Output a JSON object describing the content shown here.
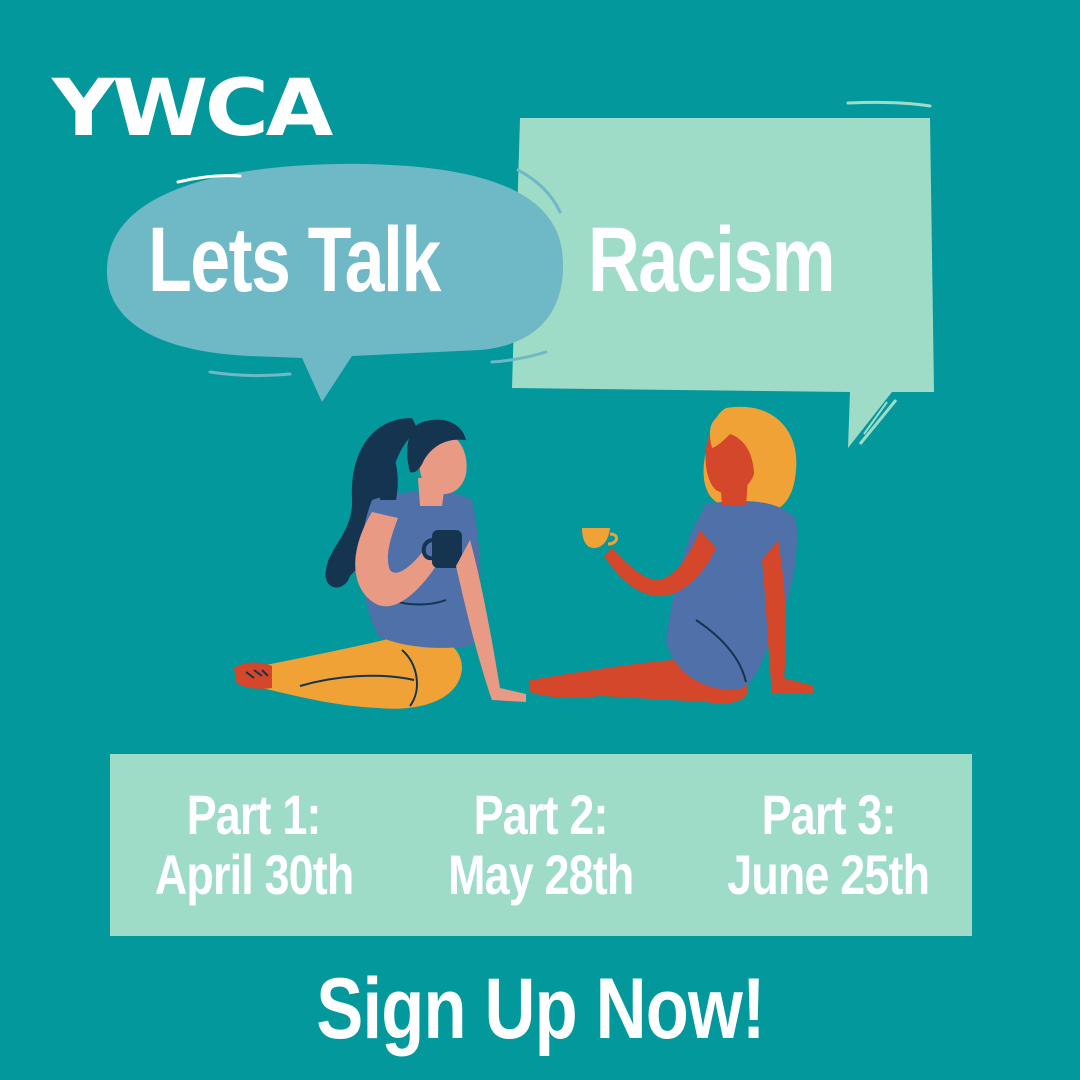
{
  "brand": {
    "logo": "YWCA"
  },
  "headline": {
    "left": "Lets Talk",
    "right": "Racism"
  },
  "schedule": [
    {
      "part": "Part 1:",
      "date": "April 30th"
    },
    {
      "part": "Part 2:",
      "date": "May 28th"
    },
    {
      "part": "Part 3:",
      "date": "June 25th"
    }
  ],
  "cta": "Sign Up Now!",
  "colors": {
    "background": "#03989c",
    "bubble_left": "#6fb8c6",
    "bubble_right": "#9edcc8",
    "panel": "#9edcc8",
    "text": "#ffffff"
  }
}
